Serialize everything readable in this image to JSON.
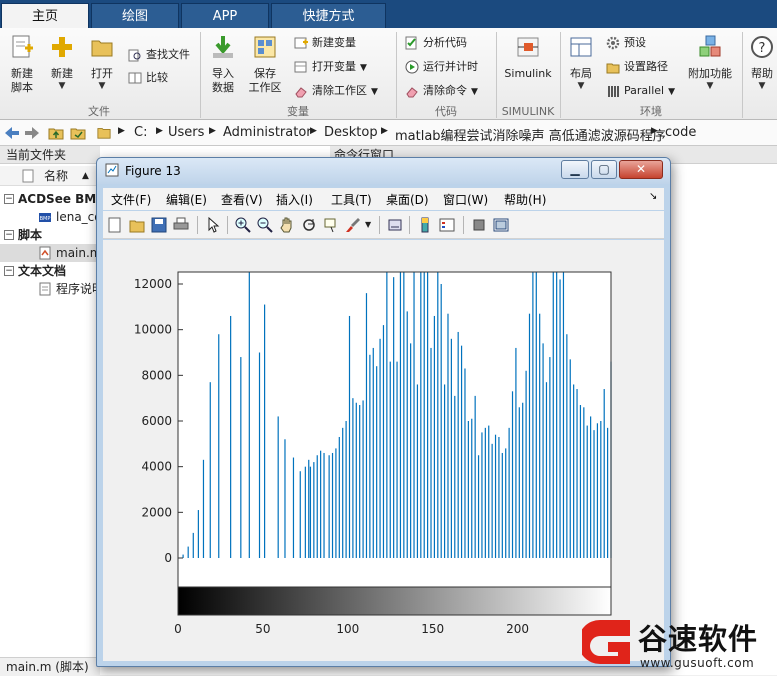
{
  "tabs": [
    "主页",
    "绘图",
    "APP",
    "快捷方式"
  ],
  "ribbon": {
    "groups": {
      "file": "文件",
      "variable": "变量",
      "code": "代码",
      "simulink": "SIMULINK",
      "env": "环境"
    },
    "new_script": "新建\n脚本",
    "new": "新建",
    "open": "打开",
    "find_files": "查找文件",
    "compare": "比较",
    "import_data": "导入\n数据",
    "save_workspace": "保存\n工作区",
    "new_variable": "新建变量",
    "open_variable": "打开变量",
    "clear_workspace": "清除工作区",
    "analyze_code": "分析代码",
    "run_and_time": "运行并计时",
    "clear_commands": "清除命令",
    "simulink": "Simulink",
    "layout": "布局",
    "preferences": "预设",
    "set_path": "设置路径",
    "parallel": "Parallel",
    "addons": "附加功能",
    "help": "帮助"
  },
  "address": {
    "crumbs": [
      "C:",
      "Users",
      "Administrator",
      "Desktop",
      "matlab编程尝试消除噪声 高低通滤波源码程序",
      "code"
    ]
  },
  "filebrowser": {
    "title": "当前文件夹",
    "col_name": "名称",
    "groups": [
      {
        "label": "ACDSee BMP",
        "items": [
          "lena_color"
        ]
      },
      {
        "label": "脚本",
        "items": [
          "main.m"
        ]
      },
      {
        "label": "文本文档",
        "items": [
          "程序说明"
        ]
      }
    ],
    "status": "main.m  (脚本)"
  },
  "command_window_title": "命令行窗口",
  "figure": {
    "title": "Figure 13",
    "menus": [
      "文件(F)",
      "编辑(E)",
      "查看(V)",
      "插入(I)",
      "工具(T)",
      "桌面(D)",
      "窗口(W)",
      "帮助(H)"
    ],
    "toolbar_icons": [
      "new-figure-icon",
      "open-file-icon",
      "save-icon",
      "print-icon",
      "pointer-icon",
      "zoom-in-icon",
      "zoom-out-icon",
      "pan-icon",
      "rotate-icon",
      "data-cursor-icon",
      "brush-icon",
      "link-plot-icon",
      "colorbar-icon",
      "legend-icon",
      "hide-tools-icon",
      "show-tools-icon"
    ]
  },
  "chart_data": {
    "type": "bar",
    "title": "",
    "xlabel": "",
    "ylabel": "",
    "xlim": [
      0,
      255
    ],
    "ylim": [
      -1400,
      14000
    ],
    "xticks": [
      0,
      50,
      100,
      150,
      200
    ],
    "yticks": [
      0,
      2000,
      4000,
      6000,
      8000,
      10000,
      12000
    ],
    "bar_color": "#0072bd",
    "colorbar": "grayscale",
    "series": [
      {
        "x": [
          3,
          6,
          9,
          12,
          15,
          19,
          24,
          31,
          37,
          42,
          48,
          51,
          59,
          63,
          68,
          72,
          75,
          77,
          78,
          80,
          82,
          84,
          86,
          89,
          91,
          93,
          95,
          97,
          99,
          101,
          103,
          105,
          107,
          109,
          111,
          113,
          115,
          117,
          119,
          121,
          123,
          125,
          127,
          129,
          131,
          133,
          135,
          137,
          139,
          141,
          143,
          145,
          147,
          149,
          151,
          153,
          155,
          157,
          159,
          161,
          163,
          165,
          167,
          169,
          171,
          173,
          175,
          177,
          179,
          181,
          183,
          185,
          187,
          189,
          191,
          193,
          195,
          197,
          199,
          201,
          203,
          205,
          207,
          209,
          211,
          213,
          215,
          217,
          219,
          221,
          223,
          225,
          227,
          229,
          231,
          233,
          235,
          237,
          239,
          241,
          243,
          245,
          247,
          249,
          251,
          253,
          255
        ],
        "y": [
          150,
          500,
          1100,
          2100,
          4300,
          7700,
          9800,
          10600,
          8800,
          12800,
          9000,
          11100,
          6200,
          5200,
          4400,
          3800,
          4000,
          4300,
          4000,
          4200,
          4500,
          4700,
          4600,
          4500,
          4600,
          4800,
          5300,
          5700,
          6000,
          10600,
          7000,
          6800,
          6700,
          6900,
          11600,
          8900,
          9200,
          8400,
          9600,
          10200,
          13100,
          8600,
          12300,
          8600,
          14000,
          13600,
          10800,
          9400,
          14000,
          7600,
          12700,
          14000,
          14000,
          9200,
          10600,
          14000,
          12000,
          7600,
          10700,
          9600,
          7100,
          9900,
          9300,
          8300,
          6000,
          6100,
          7100,
          4500,
          5500,
          5700,
          5800,
          5000,
          5400,
          5300,
          4600,
          4800,
          5700,
          7300,
          9200,
          6600,
          6800,
          8200,
          10700,
          12900,
          13600,
          10700,
          9400,
          7700,
          8800,
          14000,
          14000,
          12200,
          12900,
          9800,
          8700,
          7600,
          7400,
          6700,
          6600,
          5800,
          6200,
          5600,
          5900,
          6000,
          7400,
          5700,
          8600
        ]
      }
    ]
  }
}
